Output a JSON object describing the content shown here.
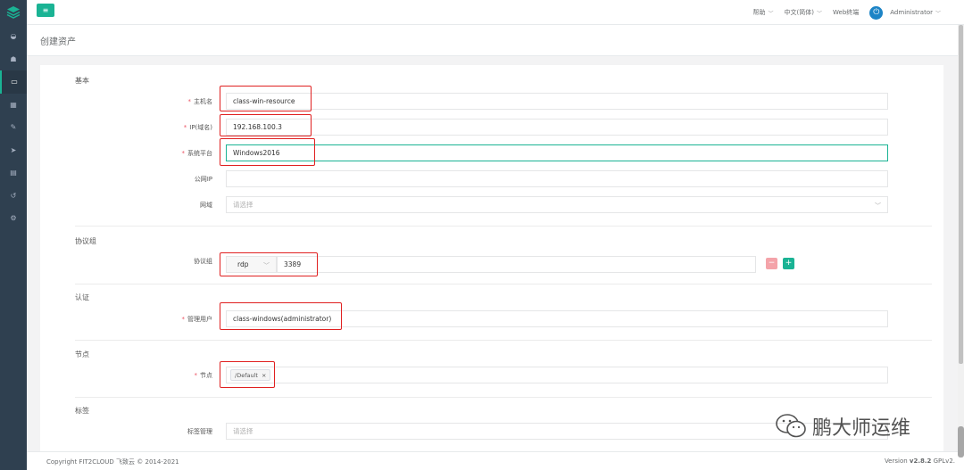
{
  "sidebar": {
    "logo_icon": "layers-logo-icon",
    "items": [
      {
        "name": "dashboard-icon",
        "glyph": "◒"
      },
      {
        "name": "users-icon",
        "glyph": "☗"
      },
      {
        "name": "assets-icon",
        "glyph": "▭"
      },
      {
        "name": "apps-icon",
        "glyph": "▦"
      },
      {
        "name": "edit-icon",
        "glyph": "✎"
      },
      {
        "name": "rocket-icon",
        "glyph": "➤"
      },
      {
        "name": "terminal-icon",
        "glyph": "▤"
      },
      {
        "name": "history-icon",
        "glyph": "↺"
      },
      {
        "name": "settings-icon",
        "glyph": "⚙"
      }
    ]
  },
  "topbar": {
    "help": "帮助",
    "language": "中文(简体)",
    "web_terminal": "Web终端",
    "user": "Administrator"
  },
  "page": {
    "title": "创建资产"
  },
  "form": {
    "sections": {
      "basic": "基本",
      "protocols": "协议组",
      "auth": "认证",
      "nodes": "节点",
      "labels": "标签"
    },
    "hostname": {
      "label": "主机名",
      "value": "class-win-resource"
    },
    "ip": {
      "label": "IP(域名)",
      "value": "192.168.100.3"
    },
    "platform": {
      "label": "系统平台",
      "value": "Windows2016"
    },
    "public_ip": {
      "label": "公网IP",
      "value": ""
    },
    "domain": {
      "label": "网域",
      "placeholder": "请选择"
    },
    "protocol_group": {
      "label": "协议组",
      "protocol": "rdp",
      "port": "3389"
    },
    "admin_user": {
      "label": "管理用户",
      "value": "class-windows(administrator)"
    },
    "node": {
      "label": "节点",
      "tag": "/Default",
      "tag_close": "×"
    },
    "label_manage": {
      "label": "标签管理",
      "placeholder": "请选择"
    }
  },
  "footer": {
    "copyright": "Copyright FIT2CLOUD 飞致云 © 2014-2021",
    "version_prefix": "Version ",
    "version": "v2.8.2",
    "license": " GPLv2."
  },
  "watermark": {
    "text": "鹏大师运维"
  },
  "colors": {
    "brand": "#1ab394",
    "sidebar": "#2f4050",
    "danger": "#ed5565",
    "annotation": "#e02020"
  }
}
